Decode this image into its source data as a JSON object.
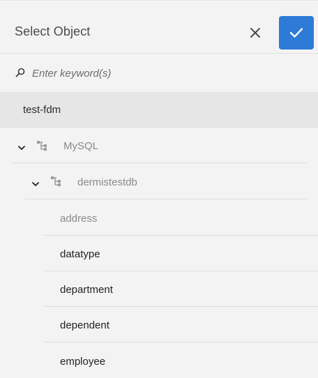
{
  "dialog": {
    "title": "Select Object",
    "close_icon": "close-icon",
    "confirm_icon": "checkmark-icon",
    "accent": "#2d7bd6"
  },
  "search": {
    "placeholder": "Enter keyword(s)",
    "value": "",
    "icon": "search-icon"
  },
  "tree": {
    "root": "test-fdm",
    "source": {
      "label": "MySQL",
      "expanded": true,
      "icon": "schema-icon"
    },
    "database": {
      "label": "dermistestdb",
      "expanded": true,
      "icon": "schema-icon"
    },
    "tables": [
      {
        "label": "address",
        "disabled": true
      },
      {
        "label": "datatype",
        "disabled": false
      },
      {
        "label": "department",
        "disabled": false
      },
      {
        "label": "dependent",
        "disabled": false
      },
      {
        "label": "employee",
        "disabled": false
      }
    ]
  }
}
